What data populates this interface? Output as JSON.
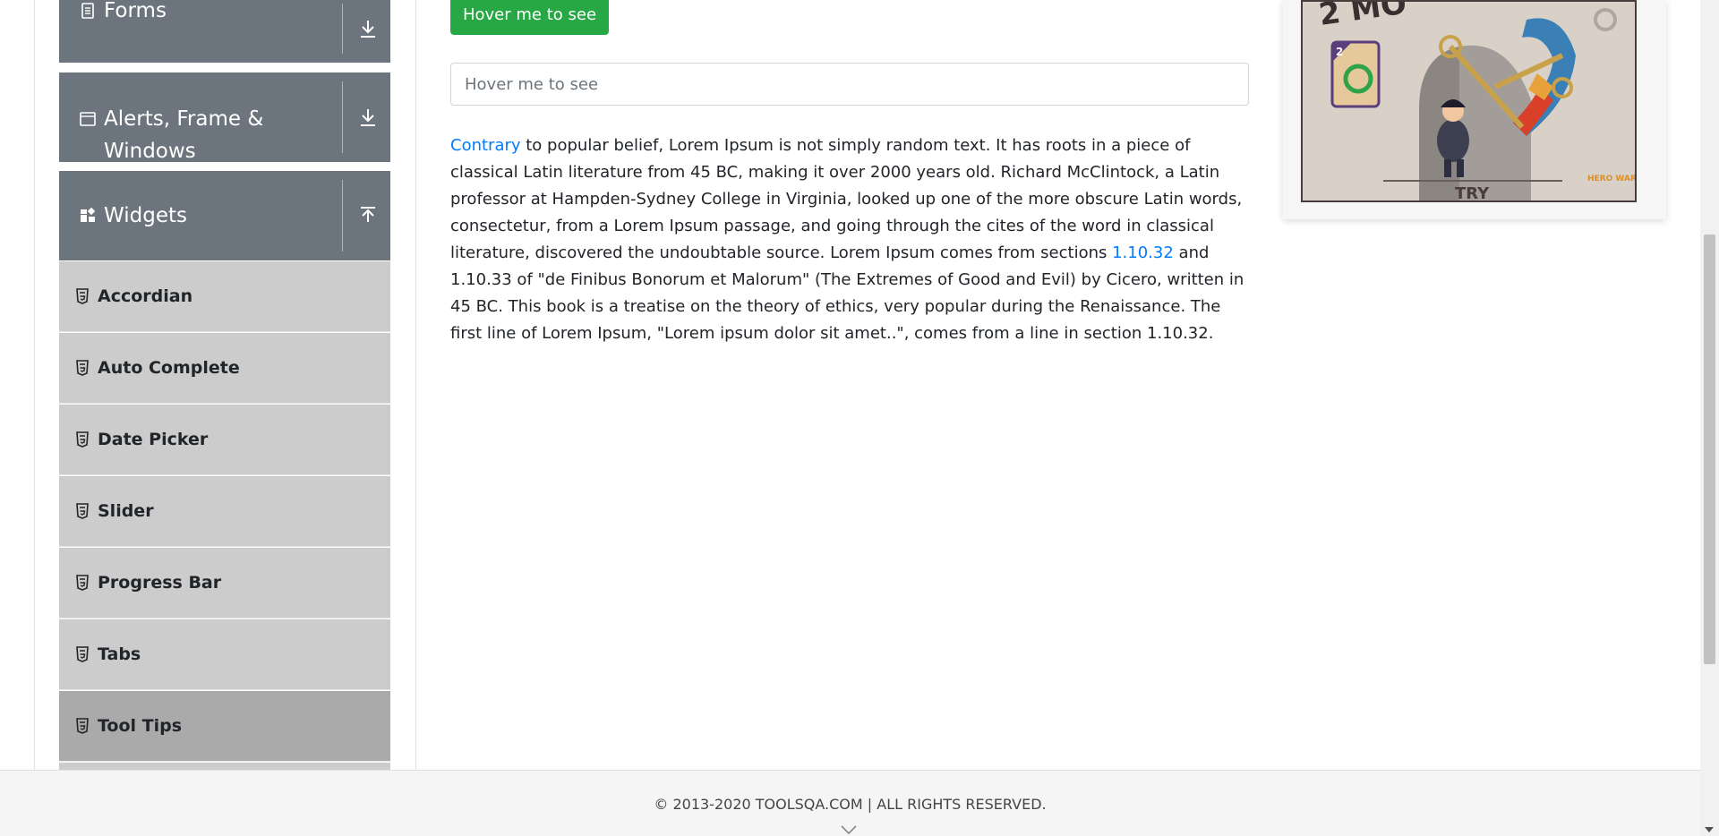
{
  "sidebar": {
    "groups": [
      {
        "label": "Forms",
        "icon": "document-icon",
        "toggle": "download-arrow-icon"
      },
      {
        "label": "Alerts, Frame & Windows",
        "icon": "window-icon",
        "toggle": "download-arrow-icon"
      },
      {
        "label": "Widgets",
        "icon": "widgets-grid-icon",
        "toggle": "upload-arrow-icon"
      }
    ],
    "items": [
      {
        "label": "Accordian",
        "active": false
      },
      {
        "label": "Auto Complete",
        "active": false
      },
      {
        "label": "Date Picker",
        "active": false
      },
      {
        "label": "Slider",
        "active": false
      },
      {
        "label": "Progress Bar",
        "active": false
      },
      {
        "label": "Tabs",
        "active": false
      },
      {
        "label": "Tool Tips",
        "active": true
      }
    ]
  },
  "main": {
    "hover_button_label": "Hover me to see",
    "hover_input_placeholder": "Hover me to see",
    "paragraph": {
      "link1": "Contrary",
      "text1": " to popular belief, Lorem Ipsum is not simply random text. It has roots in a piece of classical Latin literature from 45 BC, making it over 2000 years old. Richard McClintock, a Latin professor at Hampden-Sydney College in Virginia, looked up one of the more obscure Latin words, consectetur, from a Lorem Ipsum passage, and going through the cites of the word in classical literature, discovered the undoubtable source. Lorem Ipsum comes from sections ",
      "link2": "1.10.32",
      "text2": " and 1.10.33 of \"de Finibus Bonorum et Malorum\" (The Extremes of Good and Evil) by Cicero, written in 45 BC. This book is a treatise on the theory of ethics, very popular during the Renaissance. The first line of Lorem Ipsum, \"Lorem ipsum dolor sit amet..\", comes from a line in section 1.10.32."
    }
  },
  "ad": {
    "card_number": "2",
    "button_text": "TRY",
    "brand_text": "HERO WARS"
  },
  "footer": {
    "copyright": "© 2013-2020 TOOLSQA.COM | ALL RIGHTS RESERVED."
  },
  "colors": {
    "sidebar_header": "#6c757d",
    "menu_item": "#cccccc",
    "menu_item_active": "#aaaaaa",
    "button_green": "#28a745",
    "link_blue": "#007bff"
  }
}
